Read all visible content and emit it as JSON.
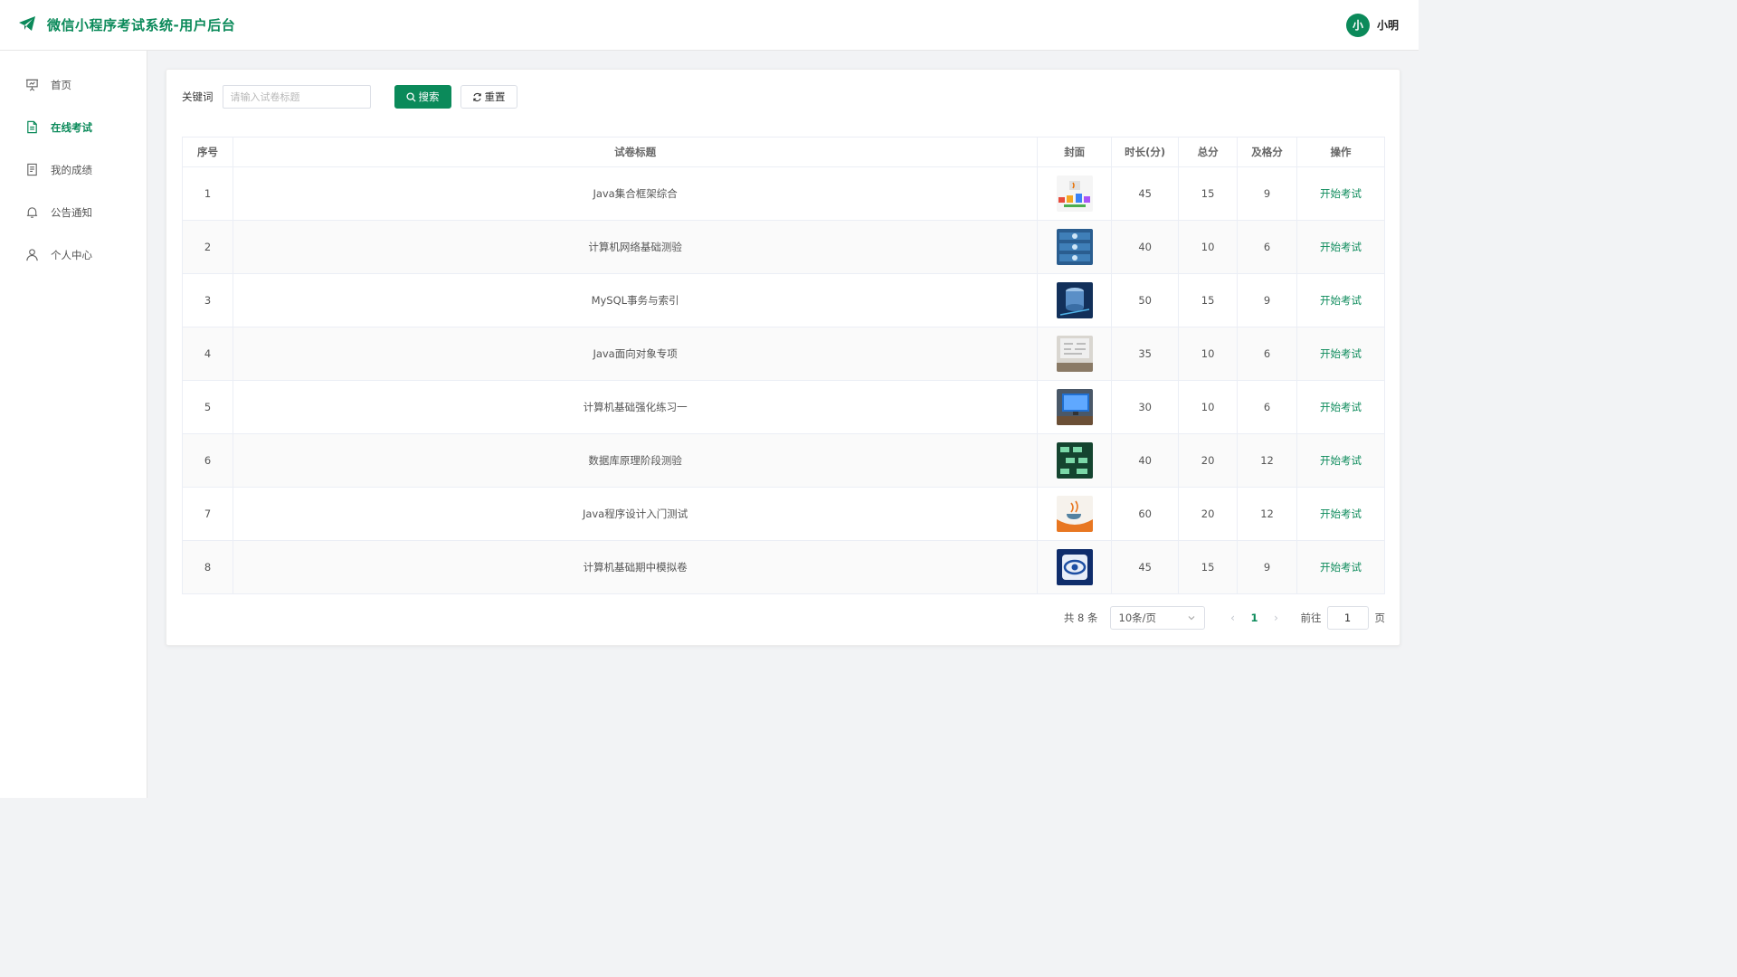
{
  "header": {
    "title": "微信小程序考试系统-用户后台",
    "avatar_text": "小",
    "user_name": "小明"
  },
  "sidebar": {
    "items": [
      {
        "label": "首页",
        "icon": "presentation-icon",
        "active": false
      },
      {
        "label": "在线考试",
        "icon": "document-icon",
        "active": true
      },
      {
        "label": "我的成绩",
        "icon": "report-icon",
        "active": false
      },
      {
        "label": "公告通知",
        "icon": "bell-icon",
        "active": false
      },
      {
        "label": "个人中心",
        "icon": "user-icon",
        "active": false
      }
    ]
  },
  "search": {
    "label": "关键词",
    "placeholder": "请输入试卷标题",
    "value": "",
    "search_button": "搜索",
    "reset_button": "重置"
  },
  "table": {
    "columns": [
      "序号",
      "试卷标题",
      "封面",
      "时长(分)",
      "总分",
      "及格分",
      "操作"
    ],
    "action_label": "开始考试",
    "rows": [
      {
        "no": "1",
        "title": "Java集合框架综合",
        "duration": "45",
        "total": "15",
        "pass": "9"
      },
      {
        "no": "2",
        "title": "计算机网络基础测验",
        "duration": "40",
        "total": "10",
        "pass": "6"
      },
      {
        "no": "3",
        "title": "MySQL事务与索引",
        "duration": "50",
        "total": "15",
        "pass": "9"
      },
      {
        "no": "4",
        "title": "Java面向对象专项",
        "duration": "35",
        "total": "10",
        "pass": "6"
      },
      {
        "no": "5",
        "title": "计算机基础强化练习一",
        "duration": "30",
        "total": "10",
        "pass": "6"
      },
      {
        "no": "6",
        "title": "数据库原理阶段测验",
        "duration": "40",
        "total": "20",
        "pass": "12"
      },
      {
        "no": "7",
        "title": "Java程序设计入门测试",
        "duration": "60",
        "total": "20",
        "pass": "12"
      },
      {
        "no": "8",
        "title": "计算机基础期中模拟卷",
        "duration": "45",
        "total": "15",
        "pass": "9"
      }
    ]
  },
  "pagination": {
    "total": "共 8 条",
    "page_size": "10条/页",
    "current": "1",
    "goto_label": "前往",
    "goto_value": "1",
    "goto_suffix": "页"
  },
  "colors": {
    "primary": "#0b8a5a",
    "background": "#f2f3f5"
  }
}
